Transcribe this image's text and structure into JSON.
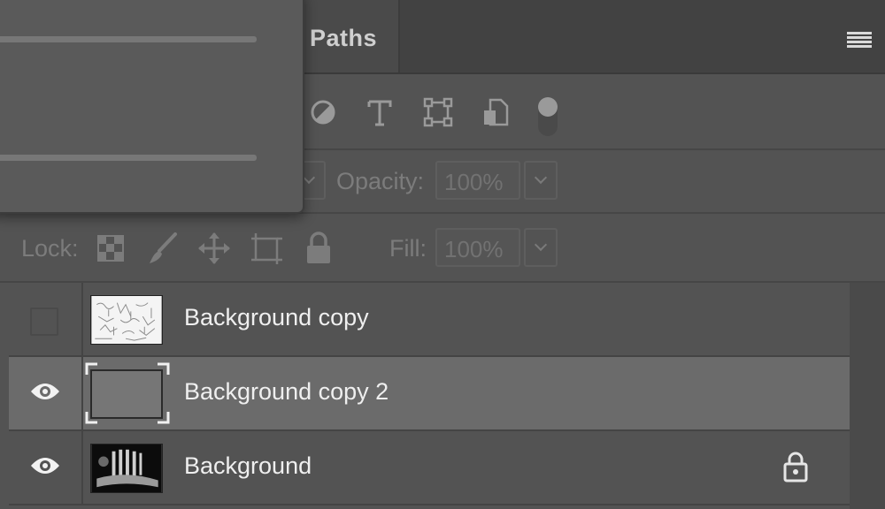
{
  "tabs": {
    "paths_label": "Paths"
  },
  "filter_icons": [
    "adjustment-filter-icon",
    "type-filter-icon",
    "shape-filter-icon",
    "smart-object-filter-icon",
    "filter-toggle-icon"
  ],
  "blend": {
    "opacity_label": "Opacity:",
    "opacity_value": "100%"
  },
  "lock": {
    "label": "Lock:",
    "fill_label": "Fill:",
    "fill_value": "100%"
  },
  "layers": [
    {
      "name": "Background copy",
      "visible": false,
      "selected": false,
      "locked": false
    },
    {
      "name": "Background copy 2",
      "visible": true,
      "selected": true,
      "locked": false
    },
    {
      "name": "Background",
      "visible": true,
      "selected": false,
      "locked": true
    }
  ]
}
